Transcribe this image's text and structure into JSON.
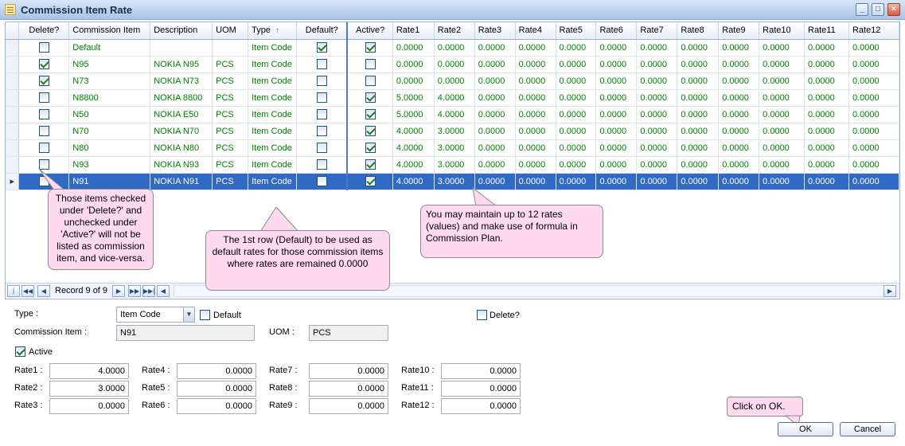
{
  "window": {
    "title": "Commission Item Rate"
  },
  "grid": {
    "columns": [
      "Delete?",
      "Commission Item",
      "Description",
      "UOM",
      "Type",
      "Default?",
      "Active?",
      "Rate1",
      "Rate2",
      "Rate3",
      "Rate4",
      "Rate5",
      "Rate6",
      "Rate7",
      "Rate8",
      "Rate9",
      "Rate10",
      "Rate11",
      "Rate12"
    ],
    "sort_indicator": "↑",
    "rows": [
      {
        "delete": false,
        "item": "Default",
        "desc": "",
        "uom": "",
        "type": "Item Code",
        "default": true,
        "active": true,
        "rates": [
          "0.0000",
          "0.0000",
          "0.0000",
          "0.0000",
          "0.0000",
          "0.0000",
          "0.0000",
          "0.0000",
          "0.0000",
          "0.0000",
          "0.0000",
          "0.0000"
        ]
      },
      {
        "delete": true,
        "item": "N95",
        "desc": "NOKIA N95",
        "uom": "PCS",
        "type": "Item Code",
        "default": false,
        "active": false,
        "rates": [
          "0.0000",
          "0.0000",
          "0.0000",
          "0.0000",
          "0.0000",
          "0.0000",
          "0.0000",
          "0.0000",
          "0.0000",
          "0.0000",
          "0.0000",
          "0.0000"
        ]
      },
      {
        "delete": true,
        "item": "N73",
        "desc": "NOKIA N73",
        "uom": "PCS",
        "type": "Item Code",
        "default": false,
        "active": false,
        "rates": [
          "0.0000",
          "0.0000",
          "0.0000",
          "0.0000",
          "0.0000",
          "0.0000",
          "0.0000",
          "0.0000",
          "0.0000",
          "0.0000",
          "0.0000",
          "0.0000"
        ]
      },
      {
        "delete": false,
        "item": "N8800",
        "desc": "NOKIA 8800",
        "uom": "PCS",
        "type": "Item Code",
        "default": false,
        "active": true,
        "rates": [
          "5.0000",
          "4.0000",
          "0.0000",
          "0.0000",
          "0.0000",
          "0.0000",
          "0.0000",
          "0.0000",
          "0.0000",
          "0.0000",
          "0.0000",
          "0.0000"
        ]
      },
      {
        "delete": false,
        "item": "N50",
        "desc": "NOKIA E50",
        "uom": "PCS",
        "type": "Item Code",
        "default": false,
        "active": true,
        "rates": [
          "5.0000",
          "4.0000",
          "0.0000",
          "0.0000",
          "0.0000",
          "0.0000",
          "0.0000",
          "0.0000",
          "0.0000",
          "0.0000",
          "0.0000",
          "0.0000"
        ]
      },
      {
        "delete": false,
        "item": "N70",
        "desc": "NOKIA N70",
        "uom": "PCS",
        "type": "Item Code",
        "default": false,
        "active": true,
        "rates": [
          "4.0000",
          "3.0000",
          "0.0000",
          "0.0000",
          "0.0000",
          "0.0000",
          "0.0000",
          "0.0000",
          "0.0000",
          "0.0000",
          "0.0000",
          "0.0000"
        ]
      },
      {
        "delete": false,
        "item": "N80",
        "desc": "NOKIA N80",
        "uom": "PCS",
        "type": "Item Code",
        "default": false,
        "active": true,
        "rates": [
          "4.0000",
          "3.0000",
          "0.0000",
          "0.0000",
          "0.0000",
          "0.0000",
          "0.0000",
          "0.0000",
          "0.0000",
          "0.0000",
          "0.0000",
          "0.0000"
        ]
      },
      {
        "delete": false,
        "item": "N93",
        "desc": "NOKIA N93",
        "uom": "PCS",
        "type": "Item Code",
        "default": false,
        "active": true,
        "rates": [
          "4.0000",
          "3.0000",
          "0.0000",
          "0.0000",
          "0.0000",
          "0.0000",
          "0.0000",
          "0.0000",
          "0.0000",
          "0.0000",
          "0.0000",
          "0.0000"
        ]
      },
      {
        "delete": false,
        "item": "N91",
        "desc": "NOKIA N91",
        "uom": "PCS",
        "type": "Item Code",
        "default": false,
        "active": true,
        "rates": [
          "4.0000",
          "3.0000",
          "0.0000",
          "0.0000",
          "0.0000",
          "0.0000",
          "0.0000",
          "0.0000",
          "0.0000",
          "0.0000",
          "0.0000",
          "0.0000"
        ],
        "selected": true
      }
    ]
  },
  "navigator": {
    "record_text": "Record 9 of 9"
  },
  "callouts": {
    "delete_note": "Those items checked under 'Delete?' and unchecked under 'Active?' will not be listed as commission item, and vice-versa.",
    "default_note": "The 1st row (Default) to be used as default rates for those commission items where rates are remained 0.0000",
    "rates_note": "You may maintain up to 12 rates (values) and make use of formula in Commission Plan.",
    "ok_note": "Click on OK."
  },
  "form": {
    "type_label": "Type :",
    "type_value": "Item Code",
    "default_label": "Default",
    "delete_label": "Delete?",
    "item_label": "Commission Item :",
    "item_value": "N91",
    "uom_label": "UOM :",
    "uom_value": "PCS",
    "active_label": "Active",
    "rates": [
      {
        "label": "Rate1 :",
        "value": "4.0000"
      },
      {
        "label": "Rate2 :",
        "value": "3.0000"
      },
      {
        "label": "Rate3 :",
        "value": "0.0000"
      },
      {
        "label": "Rate4 :",
        "value": "0.0000"
      },
      {
        "label": "Rate5 :",
        "value": "0.0000"
      },
      {
        "label": "Rate6 :",
        "value": "0.0000"
      },
      {
        "label": "Rate7 :",
        "value": "0.0000"
      },
      {
        "label": "Rate8 :",
        "value": "0.0000"
      },
      {
        "label": "Rate9 :",
        "value": "0.0000"
      },
      {
        "label": "Rate10 :",
        "value": "0.0000"
      },
      {
        "label": "Rate11 :",
        "value": "0.0000"
      },
      {
        "label": "Rate12 :",
        "value": "0.0000"
      }
    ],
    "ok_label": "OK",
    "cancel_label": "Cancel"
  }
}
